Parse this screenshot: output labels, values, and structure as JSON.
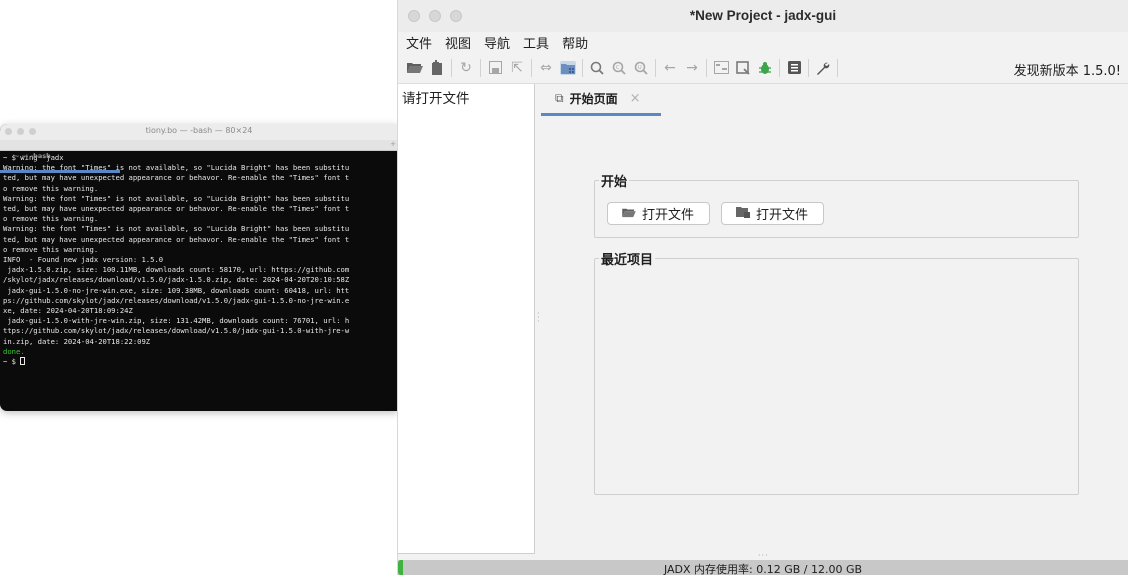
{
  "terminal": {
    "title": "tiony.bo — -bash — 80×24",
    "tab": "~ — -bash",
    "lines": [
      "~ $ wing -jadx",
      "Warning: the font \"Times\" is not available, so \"Lucida Bright\" has been substitu",
      "ted, but may have unexpected appearance or behavor. Re-enable the \"Times\" font t",
      "o remove this warning.",
      "Warning: the font \"Times\" is not available, so \"Lucida Bright\" has been substitu",
      "ted, but may have unexpected appearance or behavor. Re-enable the \"Times\" font t",
      "o remove this warning.",
      "Warning: the font \"Times\" is not available, so \"Lucida Bright\" has been substitu",
      "ted, but may have unexpected appearance or behavor. Re-enable the \"Times\" font t",
      "o remove this warning.",
      "INFO  - Found new jadx version: 1.5.0",
      " jadx-1.5.0.zip, size: 100.11MB, downloads count: 58170, url: https://github.com",
      "/skylot/jadx/releases/download/v1.5.0/jadx-1.5.0.zip, date: 2024-04-20T20:10:58Z",
      " jadx-gui-1.5.0-no-jre-win.exe, size: 109.38MB, downloads count: 60418, url: htt",
      "ps://github.com/skylot/jadx/releases/download/v1.5.0/jadx-gui-1.5.0-no-jre-win.e",
      "xe, date: 2024-04-20T18:09:24Z",
      " jadx-gui-1.5.0-with-jre-win.zip, size: 131.42MB, downloads count: 76701, url: h",
      "ttps://github.com/skylot/jadx/releases/download/v1.5.0/jadx-gui-1.5.0-with-jre-w",
      "in.zip, date: 2024-04-20T18:22:09Z",
      ""
    ],
    "done_line": "done.",
    "prompt": "~ $ "
  },
  "app": {
    "title": "*New Project - jadx-gui",
    "menu": [
      "文件",
      "视图",
      "导航",
      "工具",
      "帮助"
    ],
    "update_notice": "发现新版本 1.5.0!",
    "left_panel_message": "请打开文件",
    "tab_label": "开始页面",
    "start_group_title": "开始",
    "open_file_button_1": "打开文件",
    "open_file_button_2": "打开文件",
    "recent_group_title": "最近项目",
    "memory_status": "JADX 内存使用率:  0.12 GB / 12.00 GB",
    "memory_fraction": 0.01
  },
  "icons": {
    "open_folder": "folder-open-icon",
    "add_files": "add-files-icon",
    "reload": "reload-icon",
    "save": "save-icon",
    "export": "export-icon",
    "sync": "sync-icon",
    "flatten": "flatten-packages-icon",
    "search": "search-icon",
    "find_class": "find-class-icon",
    "find_usage": "find-usage-icon",
    "back": "back-arrow-icon",
    "forward": "forward-arrow-icon",
    "deobf": "deobfuscation-icon",
    "quark": "quark-icon",
    "debug": "debug-bug-icon",
    "log": "log-viewer-icon",
    "prefs": "wrench-icon"
  }
}
